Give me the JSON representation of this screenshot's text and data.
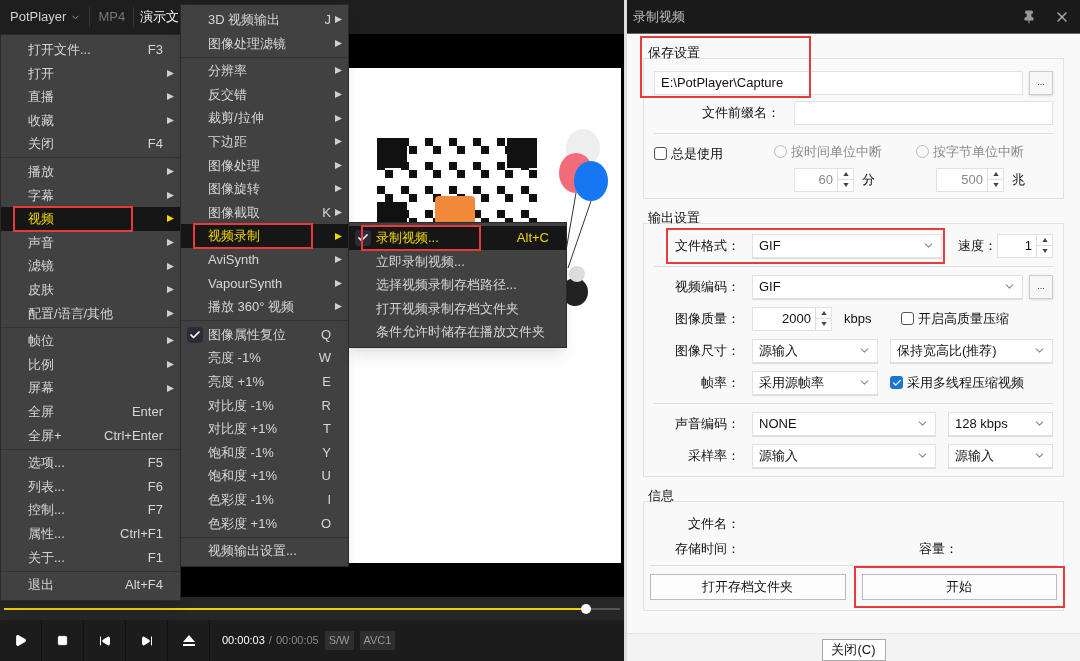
{
  "player": {
    "brand": "PotPlayer",
    "format": "MP4",
    "title": "演示文",
    "time_current": "00:00:03",
    "time_separator": "/",
    "time_total": "00:00:05",
    "badges": [
      "S/W",
      "AVC1"
    ]
  },
  "main_menu": [
    {
      "kind": "item",
      "label": "打开文件...",
      "shortcut": "F3",
      "submenu": false,
      "selected": false,
      "annotated": false
    },
    {
      "kind": "item",
      "label": "打开",
      "submenu": true,
      "selected": false,
      "annotated": false
    },
    {
      "kind": "item",
      "label": "直播",
      "submenu": true,
      "selected": false,
      "annotated": false
    },
    {
      "kind": "item",
      "label": "收藏",
      "submenu": true,
      "selected": false,
      "annotated": false
    },
    {
      "kind": "item",
      "label": "关闭",
      "shortcut": "F4",
      "submenu": false,
      "selected": false,
      "annotated": false
    },
    {
      "kind": "separator"
    },
    {
      "kind": "item",
      "label": "播放",
      "submenu": true,
      "selected": false,
      "annotated": false
    },
    {
      "kind": "item",
      "label": "字幕",
      "submenu": true,
      "selected": false,
      "annotated": false
    },
    {
      "kind": "item",
      "label": "视频",
      "submenu": true,
      "selected": true,
      "annotated": true
    },
    {
      "kind": "item",
      "label": "声音",
      "submenu": true,
      "selected": false,
      "annotated": false
    },
    {
      "kind": "item",
      "label": "滤镜",
      "submenu": true,
      "selected": false,
      "annotated": false
    },
    {
      "kind": "item",
      "label": "皮肤",
      "submenu": true,
      "selected": false,
      "annotated": false
    },
    {
      "kind": "item",
      "label": "配置/语言/其他",
      "submenu": true,
      "selected": false,
      "annotated": false
    },
    {
      "kind": "separator"
    },
    {
      "kind": "item",
      "label": "帧位",
      "submenu": true,
      "selected": false,
      "annotated": false
    },
    {
      "kind": "item",
      "label": "比例",
      "submenu": true,
      "selected": false,
      "annotated": false
    },
    {
      "kind": "item",
      "label": "屏幕",
      "submenu": true,
      "selected": false,
      "annotated": false
    },
    {
      "kind": "item",
      "label": "全屏",
      "shortcut": "Enter",
      "submenu": false,
      "selected": false,
      "annotated": false
    },
    {
      "kind": "item",
      "label": "全屏+",
      "shortcut": "Ctrl+Enter",
      "submenu": false,
      "selected": false,
      "annotated": false
    },
    {
      "kind": "separator"
    },
    {
      "kind": "item",
      "label": "选项...",
      "shortcut": "F5",
      "submenu": false,
      "selected": false,
      "annotated": false
    },
    {
      "kind": "item",
      "label": "列表...",
      "shortcut": "F6",
      "submenu": false,
      "selected": false,
      "annotated": false
    },
    {
      "kind": "item",
      "label": "控制...",
      "shortcut": "F7",
      "submenu": false,
      "selected": false,
      "annotated": false
    },
    {
      "kind": "item",
      "label": "属性...",
      "shortcut": "Ctrl+F1",
      "submenu": false,
      "selected": false,
      "annotated": false
    },
    {
      "kind": "item",
      "label": "关于...",
      "shortcut": "F1",
      "submenu": false,
      "selected": false,
      "annotated": false
    },
    {
      "kind": "separator"
    },
    {
      "kind": "item",
      "label": "退出",
      "shortcut": "Alt+F4",
      "submenu": false,
      "selected": false,
      "annotated": false
    }
  ],
  "video_menu": [
    {
      "kind": "item",
      "label": "3D 视频输出",
      "shortcut": "J",
      "submenu": true,
      "checked": false,
      "selected": false,
      "annotated": false
    },
    {
      "kind": "item",
      "label": "图像处理滤镜",
      "submenu": true,
      "checked": false,
      "selected": false,
      "annotated": false
    },
    {
      "kind": "separator"
    },
    {
      "kind": "item",
      "label": "分辨率",
      "submenu": true,
      "checked": false,
      "selected": false,
      "annotated": false
    },
    {
      "kind": "item",
      "label": "反交错",
      "submenu": true,
      "checked": false,
      "selected": false,
      "annotated": false
    },
    {
      "kind": "item",
      "label": "裁剪/拉伸",
      "submenu": true,
      "checked": false,
      "selected": false,
      "annotated": false
    },
    {
      "kind": "item",
      "label": "下边距",
      "submenu": true,
      "checked": false,
      "selected": false,
      "annotated": false
    },
    {
      "kind": "item",
      "label": "图像处理",
      "submenu": true,
      "checked": false,
      "selected": false,
      "annotated": false
    },
    {
      "kind": "item",
      "label": "图像旋转",
      "submenu": true,
      "checked": false,
      "selected": false,
      "annotated": false
    },
    {
      "kind": "item",
      "label": "图像截取",
      "shortcut": "K",
      "submenu": true,
      "checked": false,
      "selected": false,
      "annotated": false
    },
    {
      "kind": "item",
      "label": "视频录制",
      "submenu": true,
      "checked": false,
      "selected": true,
      "annotated": true
    },
    {
      "kind": "item",
      "label": "AviSynth",
      "submenu": true,
      "checked": false,
      "selected": false,
      "annotated": false
    },
    {
      "kind": "item",
      "label": "VapourSynth",
      "submenu": true,
      "checked": false,
      "selected": false,
      "annotated": false
    },
    {
      "kind": "item",
      "label": "播放 360° 视频",
      "submenu": true,
      "checked": false,
      "selected": false,
      "annotated": false
    },
    {
      "kind": "separator"
    },
    {
      "kind": "item",
      "label": "图像属性复位",
      "shortcut": "Q",
      "submenu": false,
      "checked": true,
      "selected": false,
      "annotated": false
    },
    {
      "kind": "item",
      "label": "亮度 -1%",
      "shortcut": "W",
      "submenu": false,
      "checked": false,
      "selected": false,
      "annotated": false
    },
    {
      "kind": "item",
      "label": "亮度 +1%",
      "shortcut": "E",
      "submenu": false,
      "checked": false,
      "selected": false,
      "annotated": false
    },
    {
      "kind": "item",
      "label": "对比度 -1%",
      "shortcut": "R",
      "submenu": false,
      "checked": false,
      "selected": false,
      "annotated": false
    },
    {
      "kind": "item",
      "label": "对比度 +1%",
      "shortcut": "T",
      "submenu": false,
      "checked": false,
      "selected": false,
      "annotated": false
    },
    {
      "kind": "item",
      "label": "饱和度 -1%",
      "shortcut": "Y",
      "submenu": false,
      "checked": false,
      "selected": false,
      "annotated": false
    },
    {
      "kind": "item",
      "label": "饱和度 +1%",
      "shortcut": "U",
      "submenu": false,
      "checked": false,
      "selected": false,
      "annotated": false
    },
    {
      "kind": "item",
      "label": "色彩度 -1%",
      "shortcut": "I",
      "submenu": false,
      "checked": false,
      "selected": false,
      "annotated": false
    },
    {
      "kind": "item",
      "label": "色彩度 +1%",
      "shortcut": "O",
      "submenu": false,
      "checked": false,
      "selected": false,
      "annotated": false
    },
    {
      "kind": "separator"
    },
    {
      "kind": "item",
      "label": "视频输出设置...",
      "submenu": false,
      "checked": false,
      "selected": false,
      "annotated": false
    }
  ],
  "record_menu": [
    {
      "kind": "item",
      "label": "录制视频...",
      "shortcut": "Alt+C",
      "submenu": false,
      "checked": true,
      "selected": true,
      "annotated": true
    },
    {
      "kind": "item",
      "label": "立即录制视频...",
      "submenu": false,
      "checked": false,
      "selected": false,
      "annotated": false
    },
    {
      "kind": "item",
      "label": "选择视频录制存档路径...",
      "submenu": false,
      "checked": false,
      "selected": false,
      "annotated": false
    },
    {
      "kind": "item",
      "label": "打开视频录制存档文件夹",
      "submenu": false,
      "checked": false,
      "selected": false,
      "annotated": false
    },
    {
      "kind": "item",
      "label": "条件允许时储存在播放文件夹",
      "submenu": false,
      "checked": false,
      "selected": false,
      "annotated": false
    }
  ],
  "dialog": {
    "title": "录制视频",
    "save": {
      "title": "保存设置",
      "annotated": true,
      "path": "E:\\PotPlayer\\Capture",
      "browse": "...",
      "prefix_label": "文件前缀名：",
      "always_use": {
        "label": "总是使用",
        "checked": false
      },
      "split_options": [
        {
          "label": "按时间单位中断",
          "selected": false,
          "disabled": true,
          "value": "60",
          "unit": "分"
        },
        {
          "label": "按字节单位中断",
          "selected": false,
          "disabled": true,
          "value": "500",
          "unit": "兆"
        }
      ]
    },
    "output": {
      "title": "输出设置",
      "format": {
        "label": "文件格式：",
        "value": "GIF",
        "annotated": true
      },
      "speed": {
        "label": "速度：",
        "value": "1"
      },
      "video_codec": {
        "label": "视频编码：",
        "value": "GIF",
        "browse": "..."
      },
      "quality": {
        "label": "图像质量：",
        "value": "2000",
        "unit": "kbps"
      },
      "hq": {
        "label": "开启高质量压缩",
        "checked": false
      },
      "size": {
        "label": "图像尺寸：",
        "value": "源输入",
        "aspect": "保持宽高比(推荐)"
      },
      "fps": {
        "label": "帧率：",
        "value": "采用源帧率"
      },
      "multithread": {
        "label": "采用多线程压缩视频",
        "checked": true
      },
      "audio_codec": {
        "label": "声音编码：",
        "value": "NONE",
        "bitrate": "128 kbps"
      },
      "sample_rate": {
        "label": "采样率：",
        "value": "源输入",
        "channels": "源输入"
      }
    },
    "info": {
      "title": "信息",
      "filename_label": "文件名：",
      "duration_label": "存储时间：",
      "size_label": "容量："
    },
    "buttons": [
      {
        "label": "打开存档文件夹"
      },
      {
        "label": "开始",
        "annotated": true
      }
    ],
    "close": "关闭(C)"
  }
}
